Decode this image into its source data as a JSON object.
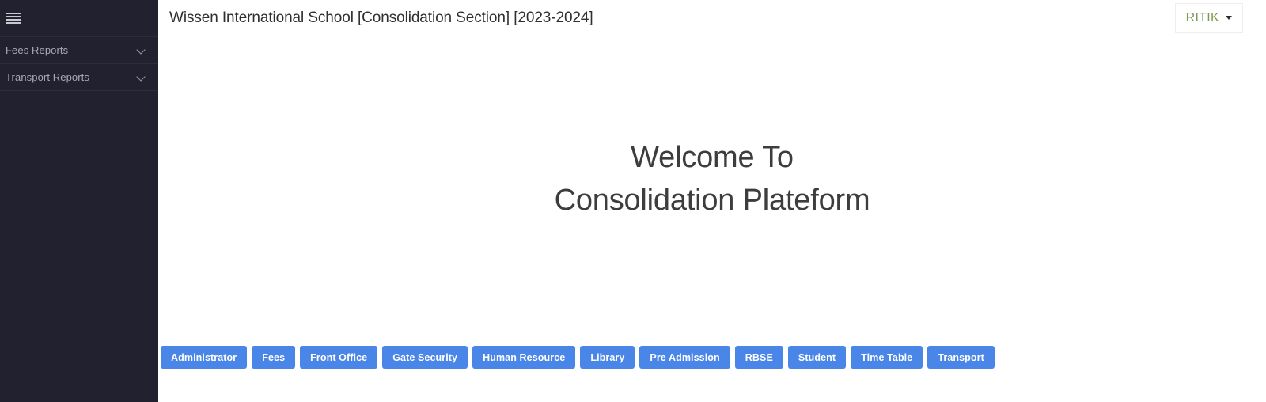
{
  "colors": {
    "sidebar_bg": "#21212f",
    "sidebar_text": "#a9a9b6",
    "header_bg": "#ffffff",
    "accent_blue": "#4a86e8",
    "user_name_color": "#7f9950",
    "content_bg": "#ffffff",
    "heading_color": "#3d3d3d"
  },
  "sidebar": {
    "toggle_icon": "hamburger-menu-icon",
    "items": [
      {
        "label": "Fees Reports",
        "icon": "chevron-down-icon",
        "expanded": false
      },
      {
        "label": "Transport Reports",
        "icon": "chevron-down-icon",
        "expanded": false
      }
    ]
  },
  "header": {
    "title": "Wissen International School [Consolidation Section] [2023-2024]",
    "user": {
      "name": "RITIK",
      "icon": "caret-down-icon"
    }
  },
  "main": {
    "welcome_line1": "Welcome To",
    "welcome_line2": "Consolidation Plateform",
    "modules": [
      {
        "label": "Administrator"
      },
      {
        "label": "Fees"
      },
      {
        "label": "Front Office"
      },
      {
        "label": "Gate Security"
      },
      {
        "label": "Human Resource"
      },
      {
        "label": "Library"
      },
      {
        "label": "Pre Admission"
      },
      {
        "label": "RBSE"
      },
      {
        "label": "Student"
      },
      {
        "label": "Time Table"
      },
      {
        "label": "Transport"
      }
    ]
  }
}
